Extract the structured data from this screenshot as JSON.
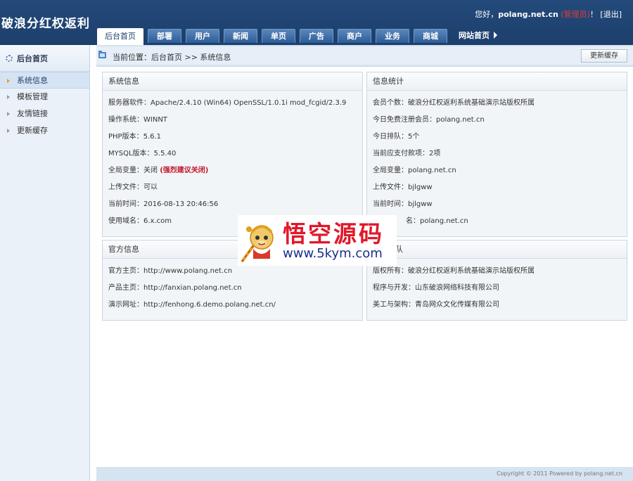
{
  "header": {
    "brand": "破浪分红权返利",
    "greeting": "您好，",
    "site": "polang.net.cn",
    "role": "(管理员)",
    "exclaim": "！",
    "logout": "[退出]"
  },
  "nav": {
    "tabs": [
      "后台首页",
      "部署",
      "用户",
      "新闻",
      "单页",
      "广告",
      "商户",
      "业务",
      "商城"
    ],
    "site_home": "网站首页"
  },
  "sidebar": {
    "title": "后台首页",
    "items": [
      "系统信息",
      "模板管理",
      "友情链接",
      "更新缓存"
    ]
  },
  "breadcrumb": {
    "text": "当前位置：后台首页 >> 系统信息",
    "refresh": "更新缓存"
  },
  "system_info": {
    "title": "系统信息",
    "rows": [
      "服务器软件：Apache/2.4.10 (Win64) OpenSSL/1.0.1i mod_fcgid/2.3.9",
      "操作系统：WINNT",
      "PHP版本：5.6.1",
      "MYSQL版本：5.5.40",
      "全局变量：关闭 ",
      "上传文件：可以",
      "当前时间：2016-08-13 20:46:56",
      "使用域名：6.x.com"
    ],
    "warning": "(强烈建议关闭)"
  },
  "stats": {
    "title": "信息统计",
    "rows": [
      "会员个数：破浪分红权返利系统基础演示站版权所属",
      "今日免费注册会员：polang.net.cn",
      "今日排队：5个",
      "当前应支付款项：2项",
      "全局变量：polang.net.cn",
      "上传文件：bjlgww",
      "当前时间：bjlgww",
      "名：polang.net.cn"
    ]
  },
  "official": {
    "title": "官方信息",
    "rows": [
      "官方主页：http://www.polang.net.cn",
      "产品主页：http://fanxian.polang.net.cn",
      "演示网址：http://fenhong.6.demo.polang.net.cn/"
    ]
  },
  "team": {
    "title": "队",
    "rows": [
      "版权所有：破浪分红权返利系统基础演示站版权所属",
      "程序与开发：山东破浪网络科技有限公司",
      "美工与架构：青岛网众文化传媒有限公司"
    ]
  },
  "footer": {
    "copyright": "Copyright © 2011 Powered by polang.net.cn"
  },
  "watermark": {
    "title": "悟空源码",
    "url": "www.5kym.com"
  }
}
